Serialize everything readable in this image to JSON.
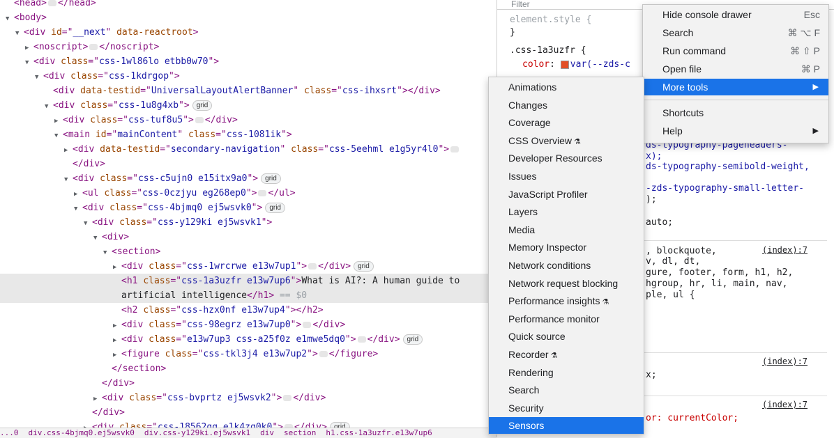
{
  "elements": {
    "rows": [
      {
        "indent": 0,
        "tri": "",
        "html": [
          [
            "tag",
            "<head>"
          ],
          [
            "ell",
            ""
          ],
          [
            "tag",
            "</head>"
          ]
        ]
      },
      {
        "indent": 0,
        "tri": "▼",
        "html": [
          [
            "tag",
            "<body>"
          ]
        ]
      },
      {
        "indent": 1,
        "tri": "▼",
        "html": [
          [
            "tag",
            "<div "
          ],
          [
            "attr",
            "id"
          ],
          [
            "tag",
            "=\""
          ],
          [
            "val",
            "__next"
          ],
          [
            "tag",
            "\" "
          ],
          [
            "attr",
            "data-reactroot"
          ],
          [
            "tag",
            ">"
          ]
        ]
      },
      {
        "indent": 2,
        "tri": "▶",
        "html": [
          [
            "tag",
            "<noscript>"
          ],
          [
            "ell",
            ""
          ],
          [
            "tag",
            "</noscript>"
          ]
        ]
      },
      {
        "indent": 2,
        "tri": "▼",
        "html": [
          [
            "tag",
            "<div "
          ],
          [
            "attr",
            "class"
          ],
          [
            "tag",
            "=\""
          ],
          [
            "val",
            "css-1wl86lo etbb0w70"
          ],
          [
            "tag",
            "\">"
          ]
        ]
      },
      {
        "indent": 3,
        "tri": "▼",
        "html": [
          [
            "tag",
            "<div "
          ],
          [
            "attr",
            "class"
          ],
          [
            "tag",
            "=\""
          ],
          [
            "val",
            "css-1kdrgop"
          ],
          [
            "tag",
            "\">"
          ]
        ]
      },
      {
        "indent": 4,
        "tri": "",
        "html": [
          [
            "tag",
            "<div "
          ],
          [
            "attr",
            "data-testid"
          ],
          [
            "tag",
            "=\""
          ],
          [
            "val",
            "UniversalLayoutAlertBanner"
          ],
          [
            "tag",
            "\" "
          ],
          [
            "attr",
            "class"
          ],
          [
            "tag",
            "=\""
          ],
          [
            "val",
            "css-ihxsrt"
          ],
          [
            "tag",
            "\"></div>"
          ]
        ]
      },
      {
        "indent": 4,
        "tri": "▼",
        "html": [
          [
            "tag",
            "<div "
          ],
          [
            "attr",
            "class"
          ],
          [
            "tag",
            "=\""
          ],
          [
            "val",
            "css-1u8g4xb"
          ],
          [
            "tag",
            "\">"
          ],
          [
            "badge",
            "grid"
          ]
        ]
      },
      {
        "indent": 5,
        "tri": "▶",
        "html": [
          [
            "tag",
            "<div "
          ],
          [
            "attr",
            "class"
          ],
          [
            "tag",
            "=\""
          ],
          [
            "val",
            "css-tuf8u5"
          ],
          [
            "tag",
            "\">"
          ],
          [
            "ell",
            ""
          ],
          [
            "tag",
            "</div>"
          ]
        ]
      },
      {
        "indent": 5,
        "tri": "▼",
        "html": [
          [
            "tag",
            "<main "
          ],
          [
            "attr",
            "id"
          ],
          [
            "tag",
            "=\""
          ],
          [
            "val",
            "mainContent"
          ],
          [
            "tag",
            "\" "
          ],
          [
            "attr",
            "class"
          ],
          [
            "tag",
            "=\""
          ],
          [
            "val",
            "css-1081ik"
          ],
          [
            "tag",
            "\">"
          ]
        ]
      },
      {
        "indent": 6,
        "tri": "▶",
        "html": [
          [
            "tag",
            "<div "
          ],
          [
            "attr",
            "data-testid"
          ],
          [
            "tag",
            "=\""
          ],
          [
            "val",
            "secondary-navigation"
          ],
          [
            "tag",
            "\" "
          ],
          [
            "attr",
            "class"
          ],
          [
            "tag",
            "=\""
          ],
          [
            "val",
            "css-5eehml e1g5yr4l0"
          ],
          [
            "tag",
            "\">"
          ],
          [
            "ell",
            ""
          ]
        ]
      },
      {
        "indent": 6,
        "tri": "",
        "html": [
          [
            "tag",
            "</div>"
          ]
        ]
      },
      {
        "indent": 6,
        "tri": "▼",
        "html": [
          [
            "tag",
            "<div "
          ],
          [
            "attr",
            "class"
          ],
          [
            "tag",
            "=\""
          ],
          [
            "val",
            "css-c5ujn0 e15itx9a0"
          ],
          [
            "tag",
            "\">"
          ],
          [
            "badge",
            "grid"
          ]
        ]
      },
      {
        "indent": 7,
        "tri": "▶",
        "html": [
          [
            "tag",
            "<ul "
          ],
          [
            "attr",
            "class"
          ],
          [
            "tag",
            "=\""
          ],
          [
            "val",
            "css-0czjyu eg268ep0"
          ],
          [
            "tag",
            "\">"
          ],
          [
            "ell",
            ""
          ],
          [
            "tag",
            "</ul>"
          ]
        ]
      },
      {
        "indent": 7,
        "tri": "▼",
        "html": [
          [
            "tag",
            "<div "
          ],
          [
            "attr",
            "class"
          ],
          [
            "tag",
            "=\""
          ],
          [
            "val",
            "css-4bjmq0 ej5wsvk0"
          ],
          [
            "tag",
            "\">"
          ],
          [
            "badge",
            "grid"
          ]
        ]
      },
      {
        "indent": 8,
        "tri": "▼",
        "html": [
          [
            "tag",
            "<div "
          ],
          [
            "attr",
            "class"
          ],
          [
            "tag",
            "=\""
          ],
          [
            "val",
            "css-y129ki ej5wsvk1"
          ],
          [
            "tag",
            "\">"
          ]
        ]
      },
      {
        "indent": 9,
        "tri": "▼",
        "html": [
          [
            "tag",
            "<div>"
          ]
        ]
      },
      {
        "indent": 10,
        "tri": "▼",
        "html": [
          [
            "tag",
            "<section>"
          ]
        ]
      },
      {
        "indent": 11,
        "tri": "▶",
        "html": [
          [
            "tag",
            "<div "
          ],
          [
            "attr",
            "class"
          ],
          [
            "tag",
            "=\""
          ],
          [
            "val",
            "css-1wrcrwe e13w7up1"
          ],
          [
            "tag",
            "\">"
          ],
          [
            "ell",
            ""
          ],
          [
            "tag",
            "</div>"
          ],
          [
            "badge",
            "grid"
          ]
        ]
      },
      {
        "indent": 11,
        "tri": "",
        "sel": true,
        "html": [
          [
            "tag",
            "<h1 "
          ],
          [
            "attr",
            "class"
          ],
          [
            "tag",
            "=\""
          ],
          [
            "val",
            "css-1a3uzfr e13w7up6"
          ],
          [
            "tag",
            "\">"
          ],
          [
            "txt",
            "What is AI?: A human guide to"
          ]
        ]
      },
      {
        "indent": 11,
        "tri": "",
        "sel": true,
        "html": [
          [
            "txt",
            "artificial intelligence"
          ],
          [
            "tag",
            "</h1>"
          ],
          [
            "dim",
            " == $0"
          ]
        ]
      },
      {
        "indent": 11,
        "tri": "",
        "html": [
          [
            "tag",
            "<h2 "
          ],
          [
            "attr",
            "class"
          ],
          [
            "tag",
            "=\""
          ],
          [
            "val",
            "css-hzx0nf e13w7up4"
          ],
          [
            "tag",
            "\"></h2>"
          ]
        ]
      },
      {
        "indent": 11,
        "tri": "▶",
        "html": [
          [
            "tag",
            "<div "
          ],
          [
            "attr",
            "class"
          ],
          [
            "tag",
            "=\""
          ],
          [
            "val",
            "css-98egrz e13w7up0"
          ],
          [
            "tag",
            "\">"
          ],
          [
            "ell",
            ""
          ],
          [
            "tag",
            "</div>"
          ]
        ]
      },
      {
        "indent": 11,
        "tri": "▶",
        "html": [
          [
            "tag",
            "<div "
          ],
          [
            "attr",
            "class"
          ],
          [
            "tag",
            "=\""
          ],
          [
            "val",
            "e13w7up3 css-a25f0z e1mwe5dq0"
          ],
          [
            "tag",
            "\">"
          ],
          [
            "ell",
            ""
          ],
          [
            "tag",
            "</div>"
          ],
          [
            "badge",
            "grid"
          ]
        ]
      },
      {
        "indent": 11,
        "tri": "▶",
        "html": [
          [
            "tag",
            "<figure "
          ],
          [
            "attr",
            "class"
          ],
          [
            "tag",
            "=\""
          ],
          [
            "val",
            "css-tkl3j4 e13w7up2"
          ],
          [
            "tag",
            "\">"
          ],
          [
            "ell",
            ""
          ],
          [
            "tag",
            "</figure>"
          ]
        ]
      },
      {
        "indent": 10,
        "tri": "",
        "html": [
          [
            "tag",
            "</section>"
          ]
        ]
      },
      {
        "indent": 9,
        "tri": "",
        "html": [
          [
            "tag",
            "</div>"
          ]
        ]
      },
      {
        "indent": 9,
        "tri": "▶",
        "html": [
          [
            "tag",
            "<div "
          ],
          [
            "attr",
            "class"
          ],
          [
            "tag",
            "=\""
          ],
          [
            "val",
            "css-bvprtz ej5wsvk2"
          ],
          [
            "tag",
            "\">"
          ],
          [
            "ell",
            ""
          ],
          [
            "tag",
            "</div>"
          ]
        ]
      },
      {
        "indent": 8,
        "tri": "",
        "html": [
          [
            "tag",
            "</div>"
          ]
        ]
      },
      {
        "indent": 8,
        "tri": "▶",
        "html": [
          [
            "tag",
            "<div "
          ],
          [
            "attr",
            "class"
          ],
          [
            "tag",
            "=\""
          ],
          [
            "val",
            "css-18562gg e1k4zq0k0"
          ],
          [
            "tag",
            "\">"
          ],
          [
            "ell",
            ""
          ],
          [
            "tag",
            "</div>"
          ],
          [
            "badge",
            "grid"
          ]
        ]
      }
    ],
    "breadcrumb": [
      "...0",
      "div.css-4bjmq0.ej5wsvk0",
      "div.css-y129ki.ej5wsvk1",
      "div",
      "section",
      "h1.css-1a3uzfr.e13w7up6"
    ]
  },
  "styles": {
    "filter_placeholder": "Filter",
    "element_style": "element.style {",
    "close_brace": "}",
    "rule_selector": ".css-1a3uzfr {",
    "color_prop": "color",
    "color_value": "var(--zds-c",
    "lines": [
      "ds-typography-pageheaders-",
      "x);",
      "ds-typography-semibold-weight,",
      "-zds-typography-small-letter-",
      ");",
      "auto;"
    ],
    "index_link": "(index):7",
    "selector_lines": [
      ", blockquote,",
      "v, dl, dt,",
      "gure, footer, form, h1, h2,",
      "hgroup, hr, li, main, nav,",
      "ple, ul {"
    ],
    "x_line": "x;",
    "color_current": "or: currentColor;"
  },
  "main_menu": {
    "items": [
      {
        "label": "Hide console drawer",
        "shortcut": "Esc"
      },
      {
        "label": "Search",
        "shortcut": "⌘ ⌥ F"
      },
      {
        "label": "Run command",
        "shortcut": "⌘ ⇧ P"
      },
      {
        "label": "Open file",
        "shortcut": "⌘ P"
      },
      {
        "label": "More tools",
        "shortcut": "",
        "submenu": true,
        "highlighted": true
      },
      {
        "label": "Shortcuts",
        "shortcut": ""
      },
      {
        "label": "Help",
        "shortcut": "",
        "submenu": true
      }
    ]
  },
  "submenu": {
    "items": [
      {
        "label": "Animations"
      },
      {
        "label": "Changes"
      },
      {
        "label": "Coverage"
      },
      {
        "label": "CSS Overview",
        "experimental": true
      },
      {
        "label": "Developer Resources"
      },
      {
        "label": "Issues"
      },
      {
        "label": "JavaScript Profiler"
      },
      {
        "label": "Layers"
      },
      {
        "label": "Media"
      },
      {
        "label": "Memory Inspector"
      },
      {
        "label": "Network conditions"
      },
      {
        "label": "Network request blocking"
      },
      {
        "label": "Performance insights",
        "experimental": true
      },
      {
        "label": "Performance monitor"
      },
      {
        "label": "Quick source"
      },
      {
        "label": "Recorder",
        "experimental": true
      },
      {
        "label": "Rendering"
      },
      {
        "label": "Search"
      },
      {
        "label": "Security"
      },
      {
        "label": "Sensors",
        "highlighted": true
      }
    ]
  },
  "colors": {
    "highlight": "#1a73e8",
    "tag": "#881280",
    "attr": "#994500",
    "value": "#1a1aa6"
  }
}
